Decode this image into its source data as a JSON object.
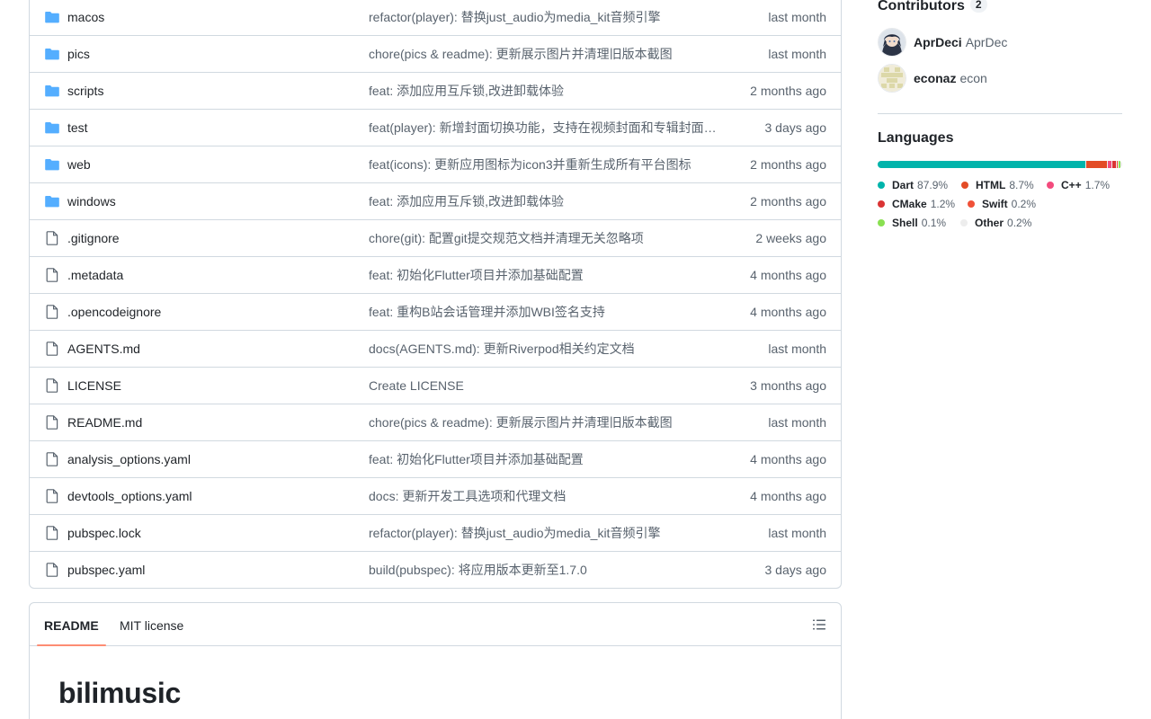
{
  "files": [
    {
      "type": "dir",
      "name": "macos",
      "commit": "refactor(player): 替换just_audio为media_kit音频引擎",
      "time": "last month"
    },
    {
      "type": "dir",
      "name": "pics",
      "commit": "chore(pics & readme): 更新展示图片并清理旧版本截图",
      "time": "last month"
    },
    {
      "type": "dir",
      "name": "scripts",
      "commit": "feat: 添加应用互斥锁,改进卸载体验",
      "time": "2 months ago"
    },
    {
      "type": "dir",
      "name": "test",
      "commit": "feat(player): 新增封面切换功能，支持在视频封面和专辑封面间切换",
      "time": "3 days ago"
    },
    {
      "type": "dir",
      "name": "web",
      "commit": "feat(icons): 更新应用图标为icon3并重新生成所有平台图标",
      "time": "2 months ago"
    },
    {
      "type": "dir",
      "name": "windows",
      "commit": "feat: 添加应用互斥锁,改进卸载体验",
      "time": "2 months ago"
    },
    {
      "type": "file",
      "name": ".gitignore",
      "commit": "chore(git): 配置git提交规范文档并清理无关忽略项",
      "time": "2 weeks ago"
    },
    {
      "type": "file",
      "name": ".metadata",
      "commit": "feat: 初始化Flutter项目并添加基础配置",
      "time": "4 months ago"
    },
    {
      "type": "file",
      "name": ".opencodeignore",
      "commit": "feat: 重构B站会话管理并添加WBI签名支持",
      "time": "4 months ago"
    },
    {
      "type": "file",
      "name": "AGENTS.md",
      "commit": "docs(AGENTS.md): 更新Riverpod相关约定文档",
      "time": "last month"
    },
    {
      "type": "file",
      "name": "LICENSE",
      "commit": "Create LICENSE",
      "time": "3 months ago"
    },
    {
      "type": "file",
      "name": "README.md",
      "commit": "chore(pics & readme): 更新展示图片并清理旧版本截图",
      "time": "last month"
    },
    {
      "type": "file",
      "name": "analysis_options.yaml",
      "commit": "feat: 初始化Flutter项目并添加基础配置",
      "time": "4 months ago"
    },
    {
      "type": "file",
      "name": "devtools_options.yaml",
      "commit": "docs: 更新开发工具选项和代理文档",
      "time": "4 months ago"
    },
    {
      "type": "file",
      "name": "pubspec.lock",
      "commit": "refactor(player): 替换just_audio为media_kit音频引擎",
      "time": "last month"
    },
    {
      "type": "file",
      "name": "pubspec.yaml",
      "commit": "build(pubspec): 将应用版本更新至1.7.0",
      "time": "3 days ago"
    }
  ],
  "readme": {
    "tabs": [
      "README",
      "MIT license"
    ],
    "title": "bilimusic"
  },
  "sidebar": {
    "contributors_label": "Contributors",
    "contributors_count": "2",
    "contributors": [
      {
        "login": "AprDeci",
        "name": "AprDec"
      },
      {
        "login": "econaz",
        "name": "econ"
      }
    ],
    "languages_label": "Languages",
    "languages": [
      {
        "name": "Dart",
        "pct": "87.9%",
        "value": 87.9,
        "color": "#00b4ab"
      },
      {
        "name": "HTML",
        "pct": "8.7%",
        "value": 8.7,
        "color": "#e34c26"
      },
      {
        "name": "C++",
        "pct": "1.7%",
        "value": 1.7,
        "color": "#f34b7d"
      },
      {
        "name": "CMake",
        "pct": "1.2%",
        "value": 1.2,
        "color": "#da3434"
      },
      {
        "name": "Swift",
        "pct": "0.2%",
        "value": 0.2,
        "color": "#f05138"
      },
      {
        "name": "Shell",
        "pct": "0.1%",
        "value": 0.1,
        "color": "#89e051"
      },
      {
        "name": "Other",
        "pct": "0.2%",
        "value": 0.2,
        "color": "#ededed"
      }
    ]
  },
  "colors": {
    "folder": "#54aeff",
    "file_icon": "#59636e",
    "accent_underline": "#fd8c73"
  }
}
